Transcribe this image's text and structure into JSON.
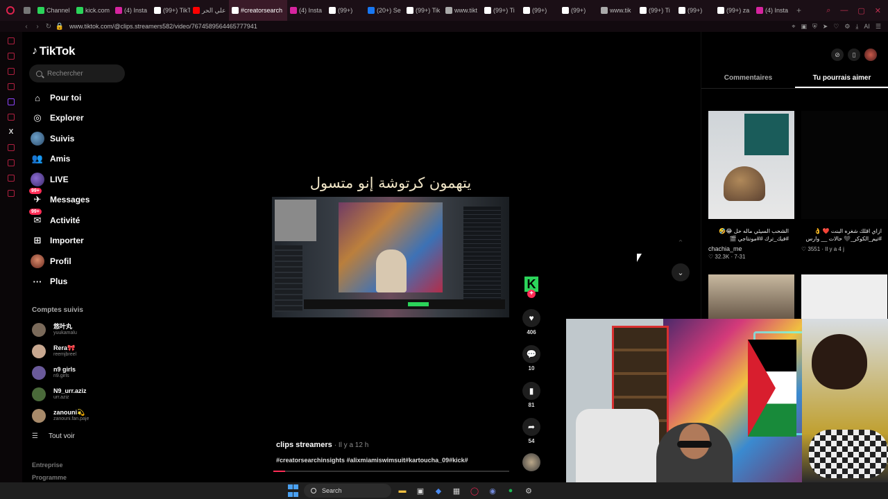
{
  "browser": {
    "tabs": [
      {
        "label": "",
        "color": "#777"
      },
      {
        "label": "Channel",
        "color": "#2bd45a"
      },
      {
        "label": "kick.com",
        "color": "#2bd45a"
      },
      {
        "label": "(4) Insta",
        "color": "#d6249f"
      },
      {
        "label": "(99+) TikT",
        "color": "#ffffff"
      },
      {
        "label": "علي الحر",
        "color": "#ff0000"
      },
      {
        "label": "#creatorsearch",
        "color": "#ffffff",
        "active": true
      },
      {
        "label": "(4) Insta",
        "color": "#d6249f"
      },
      {
        "label": "(99+)",
        "color": "#ffffff"
      },
      {
        "label": "(20+) Se",
        "color": "#1877f2"
      },
      {
        "label": "(99+) Tik",
        "color": "#ffffff"
      },
      {
        "label": "www.tikt",
        "color": "#aaaaaa"
      },
      {
        "label": "(99+) Ti",
        "color": "#ffffff"
      },
      {
        "label": "(99+)",
        "color": "#ffffff"
      },
      {
        "label": "(99+)",
        "color": "#ffffff"
      },
      {
        "label": "www.tik",
        "color": "#aaaaaa"
      },
      {
        "label": "(99+) Ti",
        "color": "#ffffff"
      },
      {
        "label": "(99+)",
        "color": "#ffffff"
      },
      {
        "label": "(99+) za",
        "color": "#ffffff"
      },
      {
        "label": "(4) Insta",
        "color": "#d6249f"
      }
    ],
    "new_tab": "+",
    "url": "www.tiktok.com/@clips.streamers582/video/7674589564465777941",
    "ai_label": "AI"
  },
  "tiktok": {
    "logo_text": "TikTok",
    "search_placeholder": "Rechercher",
    "nav": [
      {
        "label": "Pour toi",
        "icon": "home-icon",
        "glyph": "⌂"
      },
      {
        "label": "Explorer",
        "icon": "compass-icon",
        "glyph": "◎"
      },
      {
        "label": "Suivis",
        "icon": "following-avatar-icon",
        "glyph": ""
      },
      {
        "label": "Amis",
        "icon": "friends-icon",
        "glyph": "👥"
      },
      {
        "label": "LIVE",
        "icon": "live-icon",
        "glyph": ""
      },
      {
        "label": "Messages",
        "icon": "messages-icon",
        "glyph": "✈",
        "badge": "99+"
      },
      {
        "label": "Activité",
        "icon": "activity-icon",
        "glyph": "✉",
        "badge": "99+"
      },
      {
        "label": "Importer",
        "icon": "upload-icon",
        "glyph": "⊞"
      },
      {
        "label": "Profil",
        "icon": "profile-icon",
        "glyph": ""
      },
      {
        "label": "Plus",
        "icon": "more-icon",
        "glyph": "···"
      }
    ],
    "following_title": "Comptes suivis",
    "following": [
      {
        "name": "悠叶丸",
        "handle": "yuukamalu",
        "color": "#7a6a5a"
      },
      {
        "name": "Rera🎀",
        "handle": "reemjbreel",
        "color": "#c8a890"
      },
      {
        "name": "n9 girls",
        "handle": "n9.girls",
        "color": "#6a5a9a"
      },
      {
        "name": "N9_urr.aziz",
        "handle": "urr.aziz",
        "color": "#4a6a3a"
      },
      {
        "name": "zanouni💫",
        "handle": "zanouni.fan.paje",
        "color": "#a88a6a"
      }
    ],
    "see_all": "Tout voir",
    "footer": [
      "Entreprise",
      "Programme"
    ]
  },
  "video": {
    "caption_overlay": "يتهمون كرتوشة إنو متسول",
    "author": "clips streamers",
    "time_ago": "· Il y a 12 h",
    "hashtags": "#creatorsearchinsights #alixmiamiswimsuit#kartoucha_09#kick#",
    "progress_fraction": 0.05,
    "actions": {
      "likes": "406",
      "comments": "10",
      "saves": "81",
      "shares": "54"
    }
  },
  "right_panel": {
    "tabs": [
      "Commentaires",
      "Tu pourrais aimer"
    ],
    "active_tab": 1,
    "items": [
      {
        "caption": "الشحب السيئي ماله حل 😂🤣 #فيك_ترك ##مونتاجي 🎬",
        "user": "chachia_me",
        "stats": "♡ 32.3K · 7-31"
      },
      {
        "caption": "ازاي اقلك شغره البنت ❤️ 👌 #تيم_الكوكر_🖤 حالات __ وارس 🔥 🫐 🌸",
        "user": "",
        "stats": "♡ 3551 · Il y a 4 j"
      }
    ]
  },
  "taskbar": {
    "search_label": "Search"
  }
}
